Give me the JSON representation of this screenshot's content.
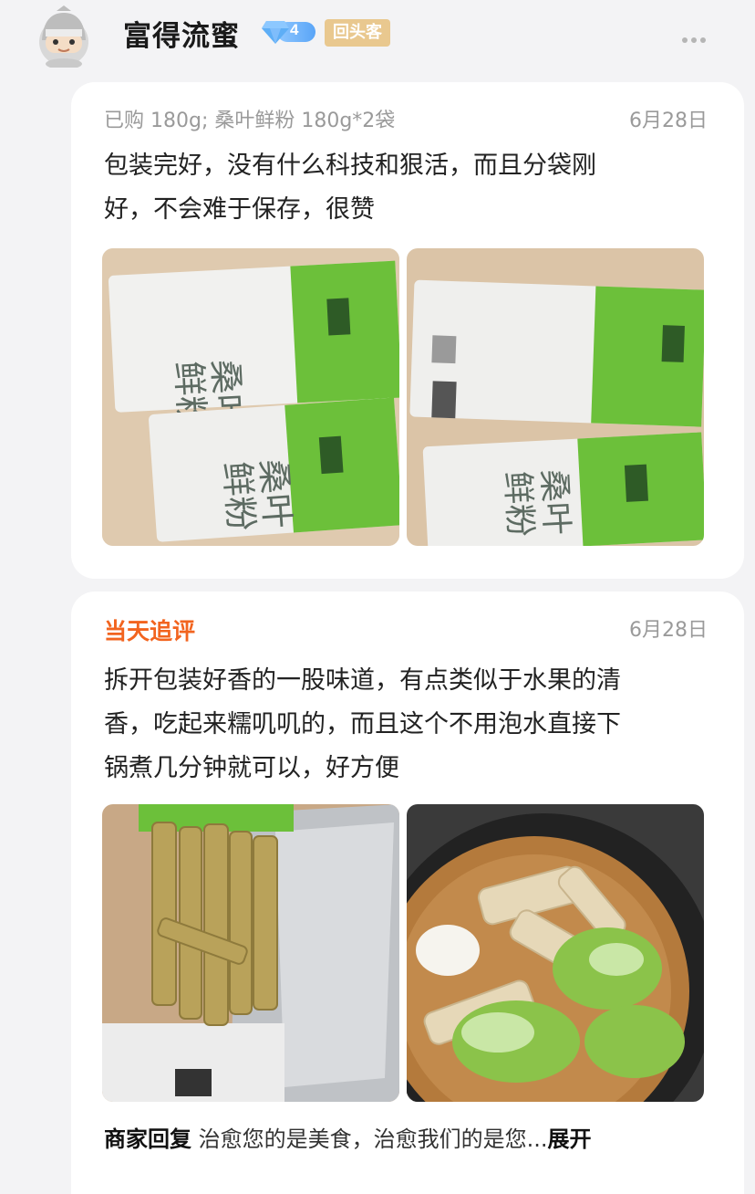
{
  "user": {
    "name": "富得流蜜",
    "vip_level": "4",
    "repeat_customer_badge": "回头客"
  },
  "review": {
    "purchase_info": "已购 180g; 桑叶鲜粉 180g*2袋",
    "date": "6月28日",
    "text": "包装完好，没有什么科技和狠活，而且分袋刚好，不会难于保存，很赞",
    "text_line1": "包装完好，没有什么科技和狠活，而且分袋刚",
    "text_line2": "好，不会难于保存，很赞",
    "photos": [
      {
        "label_a": "桑叶",
        "label_b": "鲜粉"
      },
      {
        "label_a": "桑叶",
        "label_b": "鲜粉"
      }
    ]
  },
  "followup": {
    "title": "当天追评",
    "date": "6月28日",
    "text_line1": "拆开包装好香的一股味道，有点类似于水果的清",
    "text_line2": "香，吃起来糯叽叽的，而且这个不用泡水直接下",
    "text_line3": "锅煮几分钟就可以，好方便"
  },
  "merchant_reply": {
    "label": "商家回复",
    "text": "治愈您的是美食，治愈我们的是您...",
    "expand_label": "展开"
  },
  "colors": {
    "accent_orange": "#f2641f",
    "badge_gold": "#e9c88f",
    "vip_blue": "#5aa5f7",
    "package_green": "#5cb82e"
  },
  "icons": [
    "avatar",
    "diamond-icon",
    "more-icon"
  ]
}
